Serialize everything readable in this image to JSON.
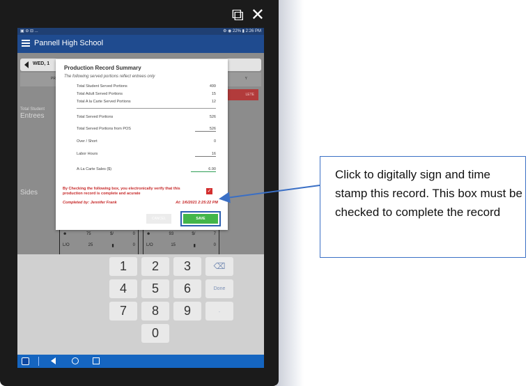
{
  "window": {
    "open_external_icon": "open-external-icon",
    "close_icon": "close-icon"
  },
  "status": {
    "left": "▣ ⊖ ⊟ ...",
    "right": "⚙ ◉ 22% ▮ 2:26 PM"
  },
  "app": {
    "title": "Pannell High School"
  },
  "background": {
    "date_label": "WED, 1",
    "tab_pr": "PR",
    "tab_y": "Y",
    "red_button": "LETE",
    "total_student": "Total Student",
    "entrees": "Entrees",
    "sides": "Sides"
  },
  "counters_left": {
    "r1": [
      "75",
      "$/",
      "0"
    ],
    "r2": [
      "L/O",
      "25",
      "0"
    ]
  },
  "counters_right": {
    "r1": [
      "93",
      "$/",
      "7"
    ],
    "r2": [
      "L/O",
      "15",
      "0"
    ]
  },
  "dialog": {
    "title": "Production Record Summary",
    "subtitle": "The following served portions reflect entrees only",
    "rows": [
      {
        "label": "Total Student Served Portions",
        "value": "499"
      },
      {
        "label": "Total Adult Served Portions",
        "value": "15"
      },
      {
        "label": "Total A la Carte Served Portions",
        "value": "12"
      },
      {
        "label": "Total Served Portions",
        "value": "526"
      },
      {
        "label": "Total Served Portions from POS",
        "value": "526"
      },
      {
        "label": "Over / Short",
        "value": "0"
      },
      {
        "label": "Labor Hours",
        "value": "16"
      },
      {
        "label": "A-La Carte Sales ($)",
        "value": "6.90"
      }
    ],
    "verify_text": "By Checking the following box, you electronically verify that this production record is complete and acurate",
    "completed_by": "Completed by:  Jennifer Frank",
    "at": "At: 1/6/2021 2:25:22 PM",
    "cancel": "CANCEL",
    "save": "SAVE"
  },
  "keypad": {
    "keys": [
      "1",
      "2",
      "3",
      "4",
      "5",
      "6",
      "7",
      "8",
      "9",
      "0"
    ],
    "done": "Done",
    "dot": "."
  },
  "callout": {
    "text": "Click to digitally sign and time stamp this record. This box must be checked to complete the record"
  }
}
